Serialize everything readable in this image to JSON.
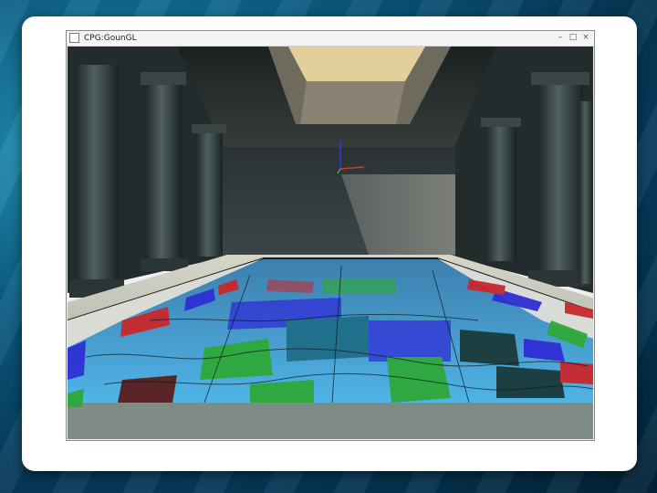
{
  "window": {
    "title": "CPG:GounGL",
    "icon": "window-app-icon",
    "controls": {
      "minimize": "–",
      "maximize": "□",
      "close": "×"
    }
  },
  "scene": {
    "description_icon": "opengl-3d-temple-pool-scene",
    "colors": {
      "stone_dark": "#2e3a3c",
      "water_blue": "#3fa3d8",
      "tile_green": "#2fa83a",
      "tile_blue": "#2f2fd6",
      "tile_red": "#c8282c",
      "skylight": "#e3cf9c"
    }
  }
}
